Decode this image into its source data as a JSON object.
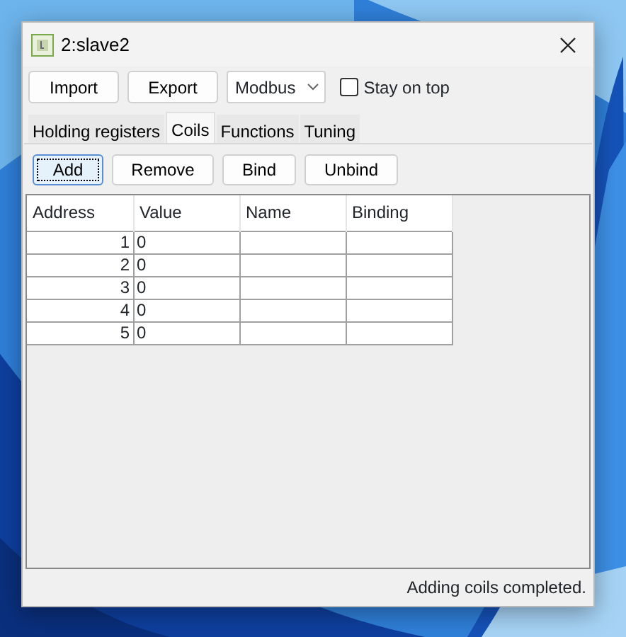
{
  "window": {
    "title": "2:slave2"
  },
  "toolbar": {
    "buttons": [
      "Import",
      "Export"
    ],
    "protocol": "Modbus",
    "stay_on_top": {
      "label": "Stay on top",
      "checked": false
    }
  },
  "tabs": [
    {
      "label": "Holding registers",
      "selected": false
    },
    {
      "label": "Coils",
      "selected": true
    },
    {
      "label": "Functions",
      "selected": false
    },
    {
      "label": "Tuning",
      "selected": false
    }
  ],
  "actions": [
    {
      "label": "Add",
      "focused": true
    },
    {
      "label": "Remove",
      "focused": false
    },
    {
      "label": "Bind",
      "focused": false
    },
    {
      "label": "Unbind",
      "focused": false
    }
  ],
  "table": {
    "columns": [
      "Address",
      "Value",
      "Name",
      "Binding"
    ],
    "rows": [
      [
        "1",
        "0",
        "",
        ""
      ],
      [
        "2",
        "0",
        "",
        ""
      ],
      [
        "3",
        "0",
        "",
        ""
      ],
      [
        "4",
        "0",
        "",
        ""
      ],
      [
        "5",
        "0",
        "",
        ""
      ]
    ]
  },
  "status_bar": "Adding coils completed."
}
